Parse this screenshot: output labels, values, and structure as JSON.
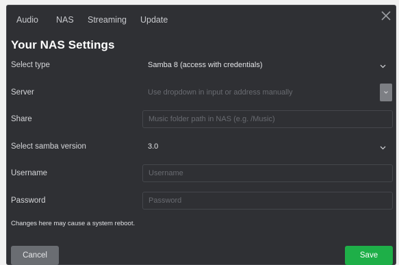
{
  "tabs": [
    {
      "label": "Audio"
    },
    {
      "label": "NAS"
    },
    {
      "label": "Streaming"
    },
    {
      "label": "Update"
    }
  ],
  "title": "Your NAS Settings",
  "fields": {
    "select_type": {
      "label": "Select type",
      "value": "Samba 8 (access with credentials)"
    },
    "server": {
      "label": "Server",
      "placeholder": "Use dropdown in input or address manually"
    },
    "share": {
      "label": "Share",
      "placeholder": "Music folder path in NAS (e.g. /Music)"
    },
    "samba_version": {
      "label": "Select samba version",
      "value": "3.0"
    },
    "username": {
      "label": "Username",
      "placeholder": "Username"
    },
    "password": {
      "label": "Password",
      "placeholder": "Password"
    }
  },
  "note": "Changes here may cause a system reboot.",
  "buttons": {
    "cancel": "Cancel",
    "save": "Save"
  },
  "colors": {
    "background": "#2f3034",
    "save": "#1eaf48",
    "cancel": "#6a6d72"
  },
  "icons": {
    "close": "close-icon",
    "chevron": "chevron-down-icon",
    "server_dropdown": "dropdown-icon"
  }
}
